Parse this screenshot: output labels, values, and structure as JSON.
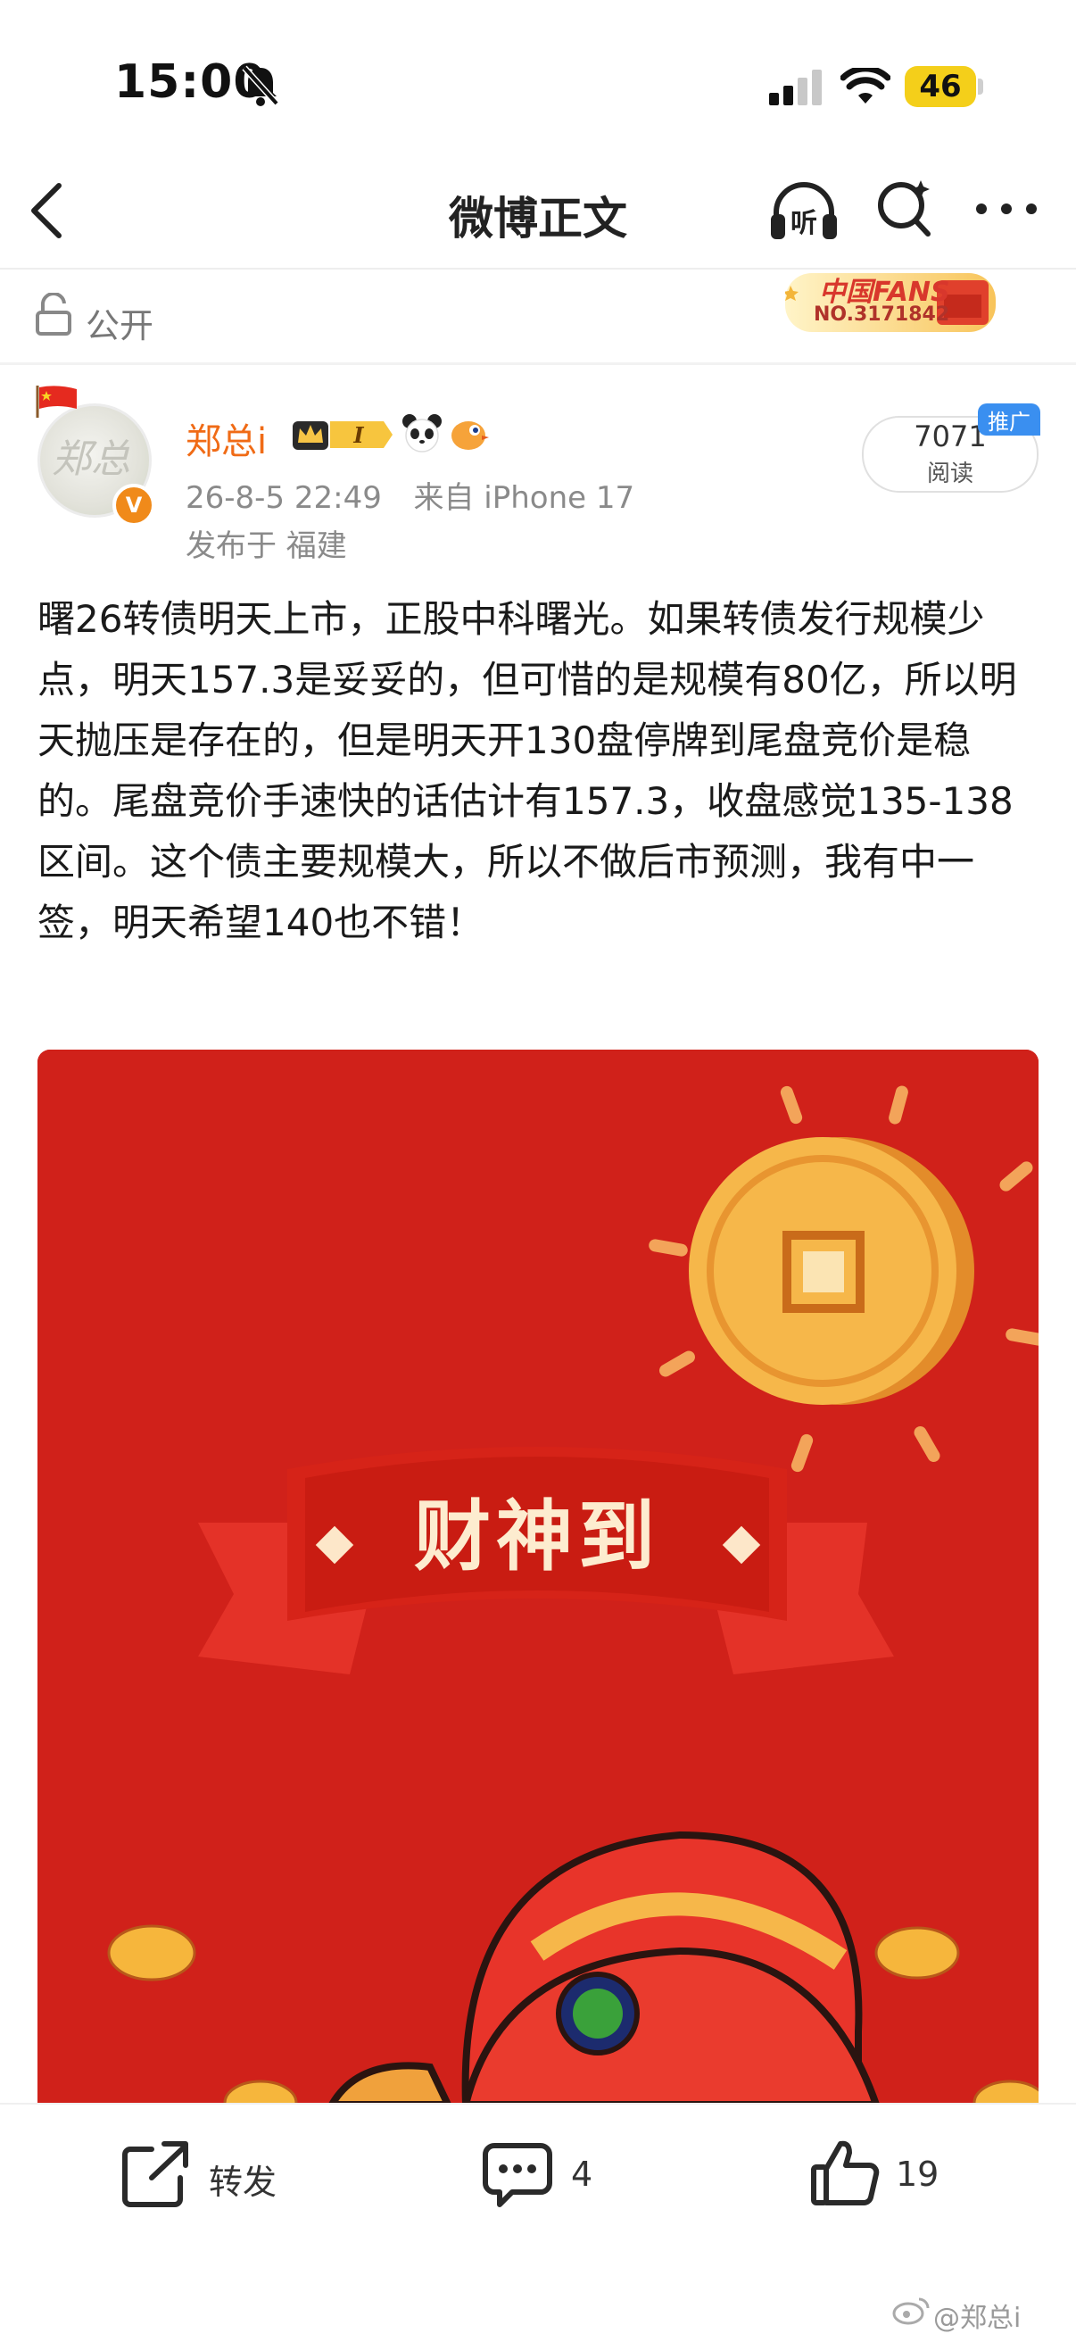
{
  "status_bar": {
    "time": "15:00",
    "battery": "46"
  },
  "nav": {
    "title": "微博正文"
  },
  "visibility": {
    "label": "公开"
  },
  "fans_badge": {
    "line1": "中国FANS",
    "line2": "NO.3171842"
  },
  "author": {
    "avatar_text": "郑总",
    "name": "郑总i",
    "level_badge": "I",
    "timestamp": "26-8-5 22:49",
    "source": "来自 iPhone 17",
    "location": "发布于 福建"
  },
  "read_stat": {
    "count": "7071",
    "label": "阅读",
    "promo": "推广"
  },
  "post": {
    "text": "曙26转债明天上市，正股中科曙光。如果转债发行规模少点，明天157.3是妥妥的，但可惜的是规模有80亿，所以明天抛压是存在的，但是明天开130盘停牌到尾盘竞价是稳的。尾盘竞价手速快的话估计有157.3，收盘感觉135-138区间。这个债主要规模大，所以不做后市预测，我有中一签，明天希望140也不错！"
  },
  "image": {
    "banner_text": "财神到"
  },
  "actions": {
    "repost_label": "转发",
    "comment_count": "4",
    "like_count": "19"
  },
  "watermark": "@郑总i",
  "colors": {
    "accent_orange": "#f06b16",
    "image_red": "#d0211a",
    "coin_gold": "#f6b74a"
  }
}
